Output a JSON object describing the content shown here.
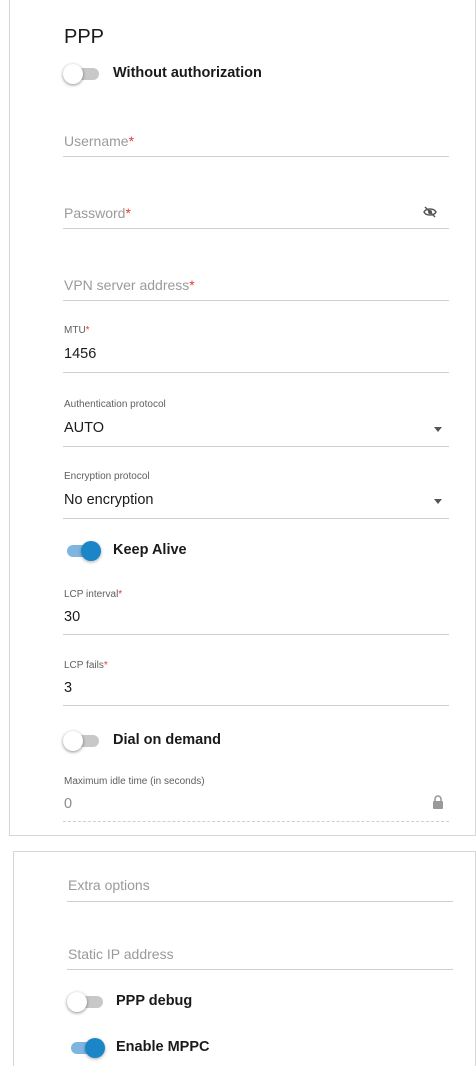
{
  "section_title": "PPP",
  "without_auth": {
    "label": "Without authorization",
    "on": false
  },
  "username": {
    "placeholder": "Username",
    "required_mark": "*"
  },
  "password": {
    "placeholder": "Password",
    "required_mark": "*",
    "icon": "eye-off-icon"
  },
  "vpn_server": {
    "placeholder": "VPN server address",
    "required_mark": "*"
  },
  "mtu": {
    "label": "MTU",
    "required_mark": "*",
    "value": "1456"
  },
  "auth_protocol": {
    "label": "Authentication protocol",
    "value": "AUTO"
  },
  "encryption_protocol": {
    "label": "Encryption protocol",
    "value": "No encryption"
  },
  "keep_alive": {
    "label": "Keep Alive",
    "on": true
  },
  "lcp_interval": {
    "label": "LCP interval",
    "required_mark": "*",
    "value": "30"
  },
  "lcp_fails": {
    "label": "LCP fails",
    "required_mark": "*",
    "value": "3"
  },
  "dial_on_demand": {
    "label": "Dial on demand",
    "on": false
  },
  "max_idle": {
    "label": "Maximum idle time (in seconds)",
    "value": "0",
    "icon": "lock-icon"
  },
  "extra_options": {
    "placeholder": "Extra options"
  },
  "static_ip": {
    "placeholder": "Static IP address"
  },
  "ppp_debug": {
    "label": "PPP debug",
    "on": false
  },
  "enable_mppc": {
    "label": "Enable MPPC",
    "on": true
  },
  "colors": {
    "accent": "#1a86c8",
    "required": "#e53935",
    "track_off": "#c8c8c8"
  }
}
